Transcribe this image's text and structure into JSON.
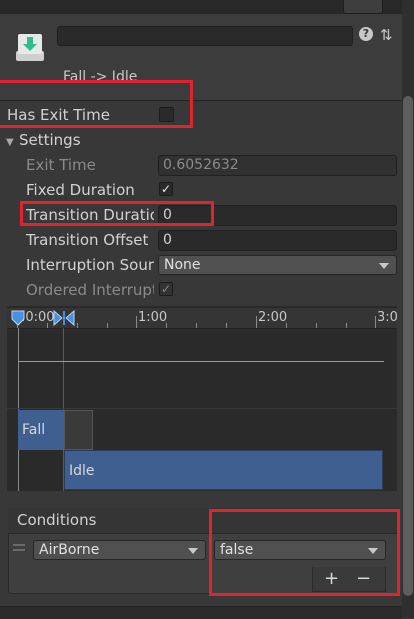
{
  "header": {
    "transition_name": "Fall -> Idle",
    "help_glyph": "?",
    "settings_glyph": "⇅"
  },
  "has_exit_time": {
    "label": "Has Exit Time",
    "checked": false
  },
  "settings": {
    "foldout_label": "Settings",
    "exit_time": {
      "label": "Exit Time",
      "value": "0.6052632"
    },
    "fixed_duration": {
      "label": "Fixed Duration",
      "checked": true
    },
    "transition_duration": {
      "label": "Transition Duratio",
      "value": "0"
    },
    "transition_offset": {
      "label": "Transition Offset",
      "value": "0"
    },
    "interruption_source": {
      "label": "Interruption Sourc",
      "value": "None"
    },
    "ordered_interruption": {
      "label": "Ordered Interruptio",
      "checked": true
    }
  },
  "timeline": {
    "ticks": [
      ":0:00",
      "1:00",
      "2:00",
      "3:0"
    ],
    "states": [
      {
        "name": "Fall"
      },
      {
        "name": "Idle"
      }
    ]
  },
  "conditions": {
    "header": "Conditions",
    "param": "AirBorne",
    "value": "false",
    "add_label": "+",
    "remove_label": "−"
  },
  "colors": {
    "highlight": "#e0232e",
    "state_blue": "#3e5f8f"
  }
}
